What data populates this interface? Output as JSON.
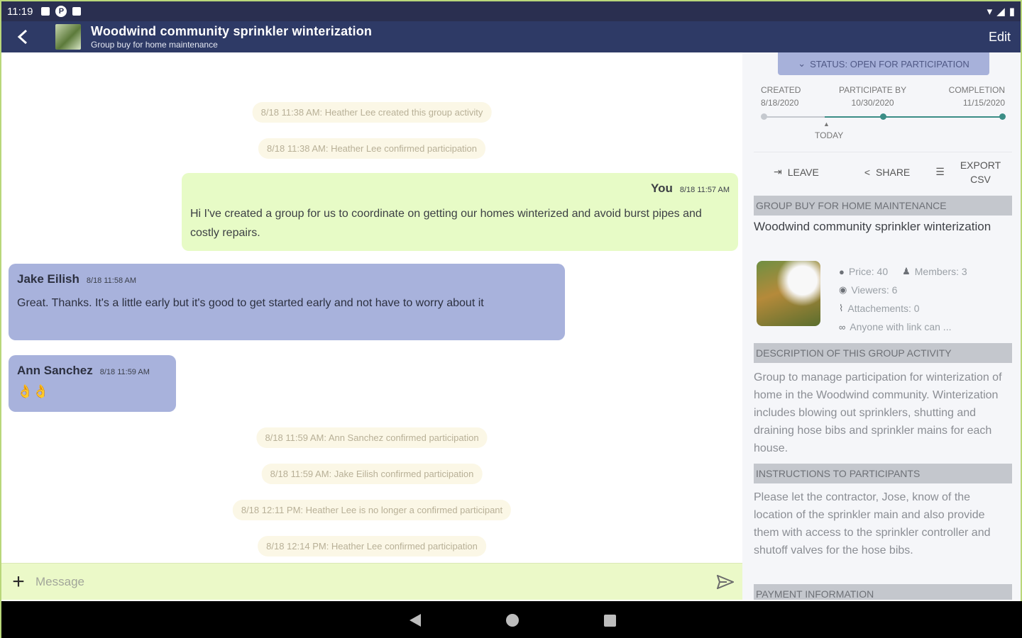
{
  "status_bar": {
    "time": "11:19"
  },
  "appbar": {
    "title": "Woodwind community sprinkler winterization",
    "subtitle": "Group buy for home maintenance",
    "edit": "Edit"
  },
  "chat": {
    "system": [
      "8/18 11:38 AM: Heather Lee created this group activity",
      "8/18 11:38 AM: Heather Lee confirmed participation",
      "8/18 11:59 AM: Ann Sanchez confirmed participation",
      "8/18 11:59 AM: Jake Eilish confirmed participation",
      "8/18 12:11 PM: Heather Lee is no longer a confirmed participant",
      "8/18 12:14 PM: Heather Lee confirmed participation"
    ],
    "messages": [
      {
        "sender": "You",
        "time": "8/18 11:57 AM",
        "text": "Hi I've created a group for us to coordinate on getting our homes winterized and avoid burst pipes and costly repairs."
      },
      {
        "sender": "Jake Eilish",
        "time": "8/18 11:58 AM",
        "text": "Great. Thanks. It's a little early but it's good to get started early and not have to worry about it"
      },
      {
        "sender": "Ann Sanchez",
        "time": "8/18 11:59 AM",
        "text": "👌👌"
      }
    ],
    "input_placeholder": "Message"
  },
  "panel": {
    "status": "STATUS: OPEN FOR PARTICIPATION",
    "timeline": {
      "created_label": "CREATED",
      "created_date": "8/18/2020",
      "participate_label": "PARTICIPATE BY",
      "participate_date": "10/30/2020",
      "completion_label": "COMPLETION",
      "completion_date": "11/15/2020",
      "today_label": "TODAY"
    },
    "actions": {
      "leave": "LEAVE",
      "share": "SHARE",
      "export_line1": "EXPORT",
      "export_line2": "CSV"
    },
    "group_header": "GROUP BUY FOR HOME MAINTENANCE",
    "item_title": "Woodwind community sprinkler winterization",
    "meta": {
      "price": "Price: 40",
      "members": "Members: 3",
      "viewers": "Viewers: 6",
      "attachments": "Attachements: 0",
      "access": "Anyone with link can ..."
    },
    "description_header": "DESCRIPTION OF THIS GROUP ACTIVITY",
    "description": "Group to manage participation for winterization of home in the Woodwind community. Winterization includes blowing out sprinklers, shutting and draining hose bibs and sprinkler mains for each house.",
    "instructions_header": "INSTRUCTIONS TO PARTICIPANTS",
    "instructions": "Please let the contractor, Jose, know of the location of the sprinkler main and also provide them with access to the sprinkler controller and shutoff valves for the hose bibs.",
    "payment_header": "PAYMENT INFORMATION"
  },
  "colors": {
    "appbar": "#2e3a66",
    "my_bubble": "#e7fbc6",
    "other_bubble": "#a8b2dc",
    "accent": "#3b8d86"
  }
}
